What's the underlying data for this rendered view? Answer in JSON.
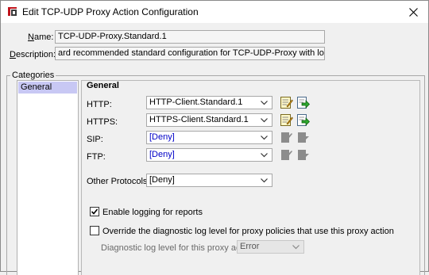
{
  "window": {
    "title": "Edit TCP-UDP Proxy Action Configuration"
  },
  "form": {
    "name_label_u": "N",
    "name_label_rest": "ame:",
    "name_value": "TCP-UDP-Proxy.Standard.1",
    "description_label_u": "D",
    "description_label_rest": "escription:",
    "description_value": "ard recommended standard configuration for TCP-UDP-Proxy with logging enabled"
  },
  "categories": {
    "title": "Categories",
    "items": [
      {
        "label": "General"
      }
    ]
  },
  "general": {
    "title": "General",
    "rows": [
      {
        "label": "HTTP:",
        "value": "HTTP-Client.Standard.1"
      },
      {
        "label": "HTTPS:",
        "value": "HTTPS-Client.Standard.1"
      },
      {
        "label": "SIP:",
        "value": "[Deny]"
      },
      {
        "label": "FTP:",
        "value": "[Deny]"
      }
    ],
    "other": {
      "label": "Other Protocols:",
      "value": "[Deny]"
    },
    "enable_logging": {
      "label": "Enable logging for reports",
      "checked": true
    },
    "override_diag": {
      "label": "Override the diagnostic log level for proxy policies that use this proxy action",
      "checked": false
    },
    "diag_level": {
      "label": "Diagnostic log level for this proxy action",
      "value": "Error"
    }
  }
}
